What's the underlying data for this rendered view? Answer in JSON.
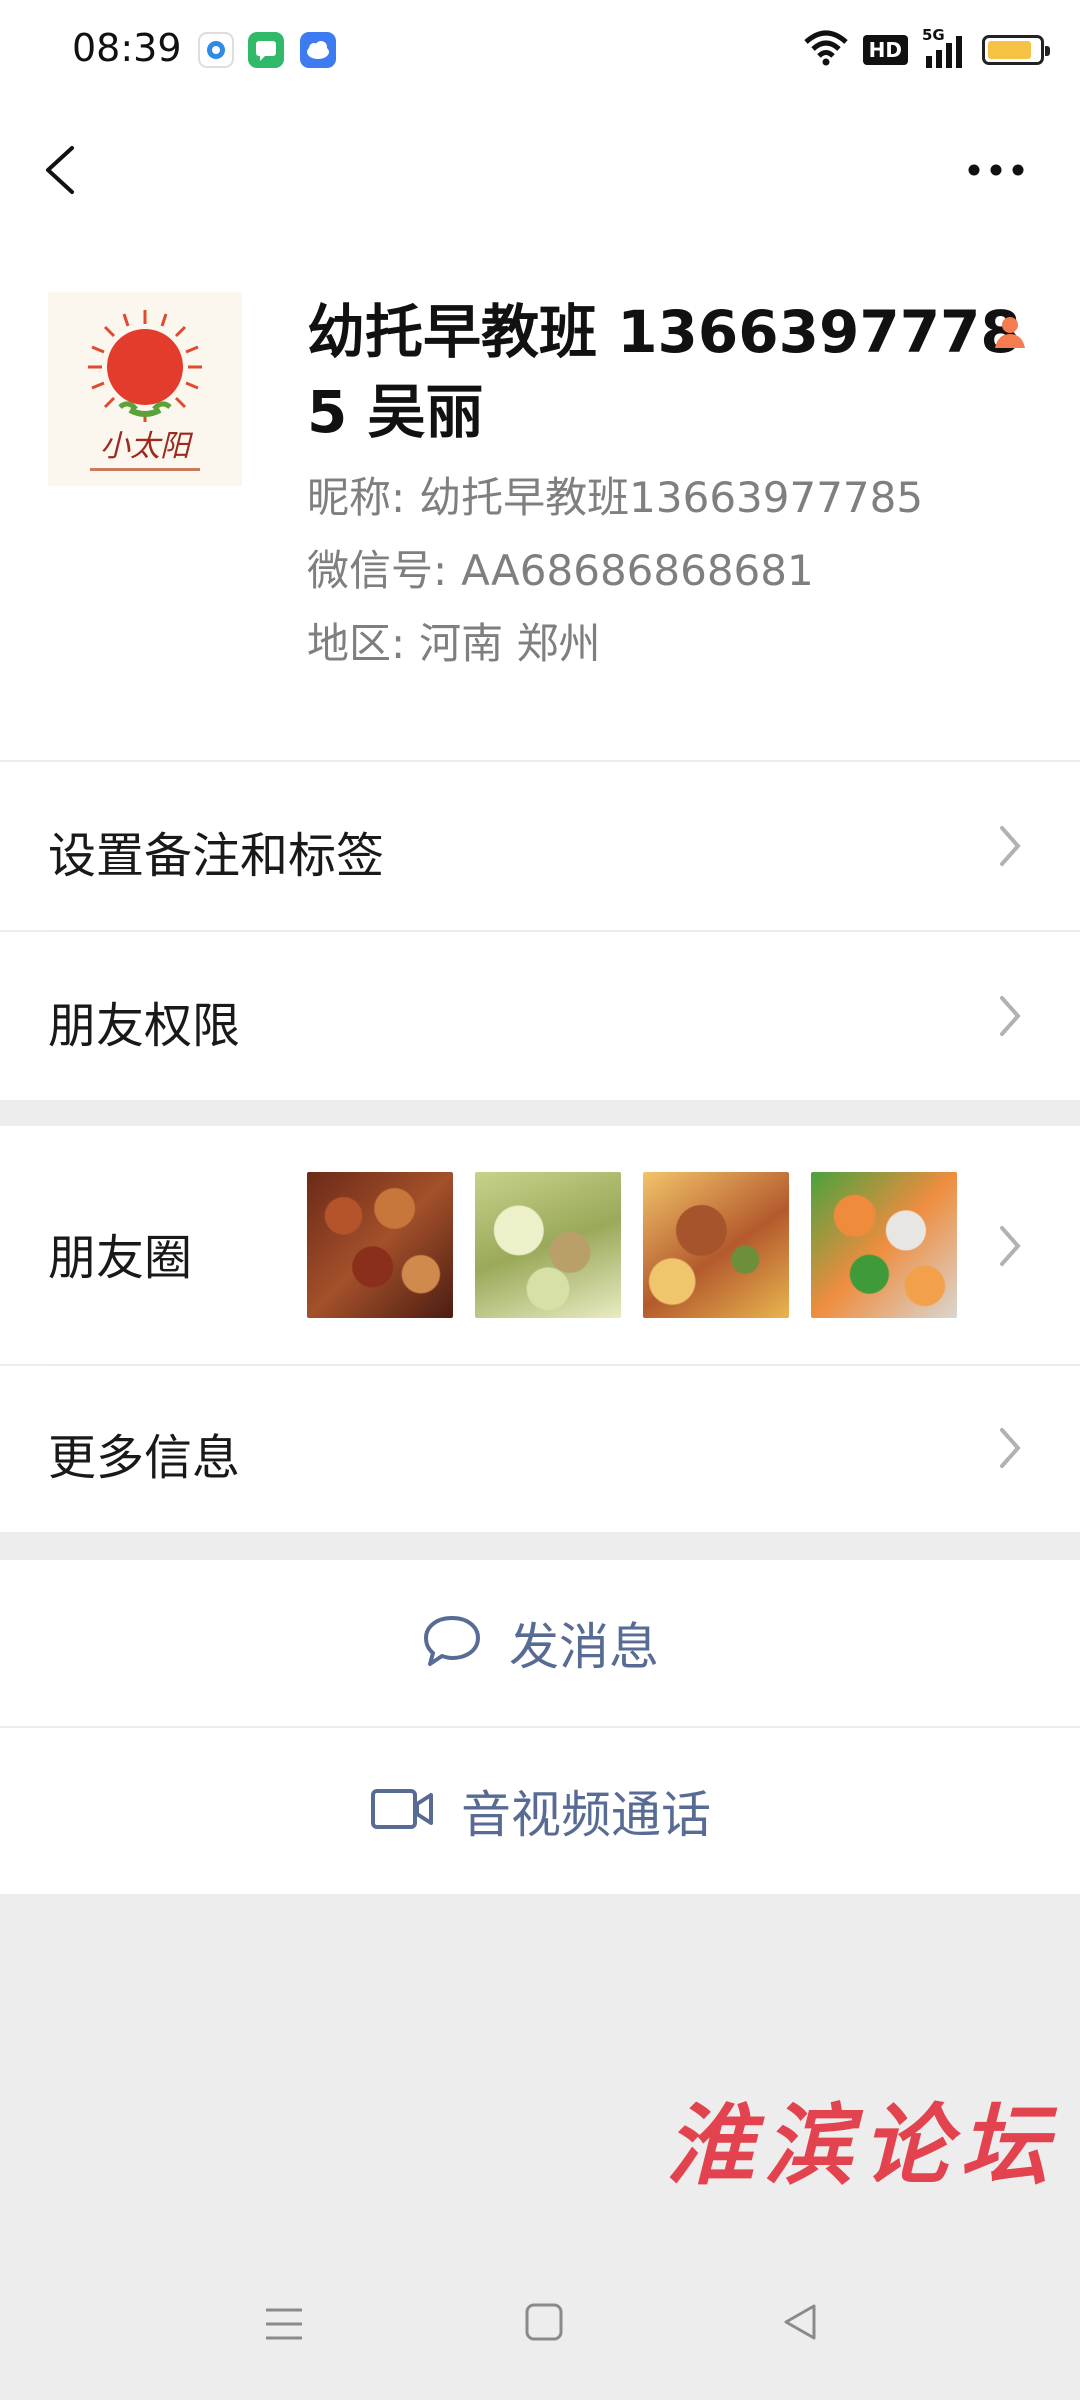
{
  "status_bar": {
    "time": "08:39",
    "icons": [
      "app-notification-icon",
      "message-notification-icon",
      "cloud-notification-icon",
      "wifi-icon",
      "hd-icon",
      "signal-5g-icon",
      "battery-icon"
    ],
    "hd_label": "HD",
    "network_label": "5G",
    "battery_level": 0.85
  },
  "nav": {
    "back_icon": "chevron-left-icon",
    "more_icon": "more-dots-icon"
  },
  "profile": {
    "avatar_text": "小太阳",
    "display_name": "幼托早教班 13663977785 吴丽",
    "gender_icon": "female-person-icon",
    "nickname_label": "昵称:",
    "nickname_value": "幼托早教班13663977785",
    "wechat_id_label": "微信号:",
    "wechat_id_value": "AA68686868681",
    "region_label": "地区:",
    "region_value": "河南  郑州"
  },
  "rows": {
    "remark_tags": "设置备注和标签",
    "friend_permissions": "朋友权限",
    "moments": "朋友圈",
    "more_info": "更多信息"
  },
  "actions": {
    "send_message": "发消息",
    "video_call": "音视频通话"
  },
  "watermark": "淮滨论坛",
  "colors": {
    "link_blue": "#576b95",
    "background_gray": "#ededed",
    "female_icon": "#f57b51",
    "watermark_red": "#e2434f"
  }
}
